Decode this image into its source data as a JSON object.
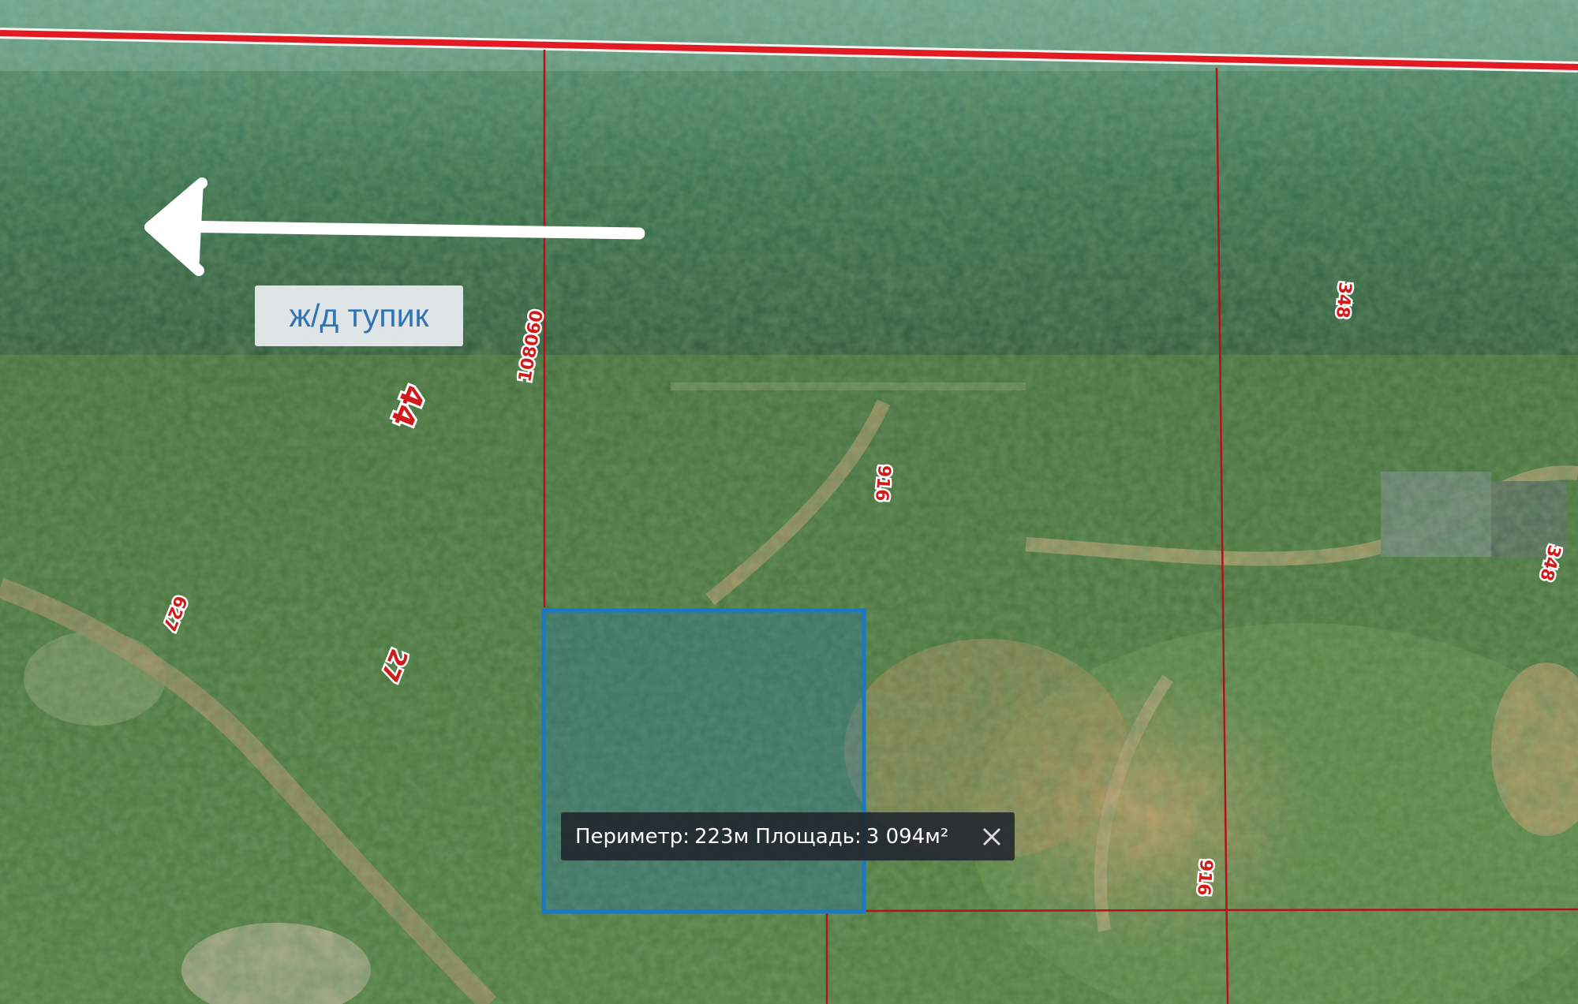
{
  "map": {
    "annotation_label": "ж/д тупик",
    "measurement": {
      "perimeter_label": "Периметр:",
      "perimeter_value": "223м",
      "area_label": "Площадь:",
      "area_value": "3 094м²"
    },
    "parcel_labels": [
      "108060",
      "44",
      "627",
      "27",
      "916",
      "348",
      "348",
      "916"
    ],
    "colors": {
      "boundary_red": "#e21b23",
      "thin_boundary": "#b3121c",
      "selection_blue": "#1a78c8",
      "annotation_text": "#2f74b5"
    },
    "icons": [
      "arrow-left-icon",
      "close-icon"
    ]
  }
}
